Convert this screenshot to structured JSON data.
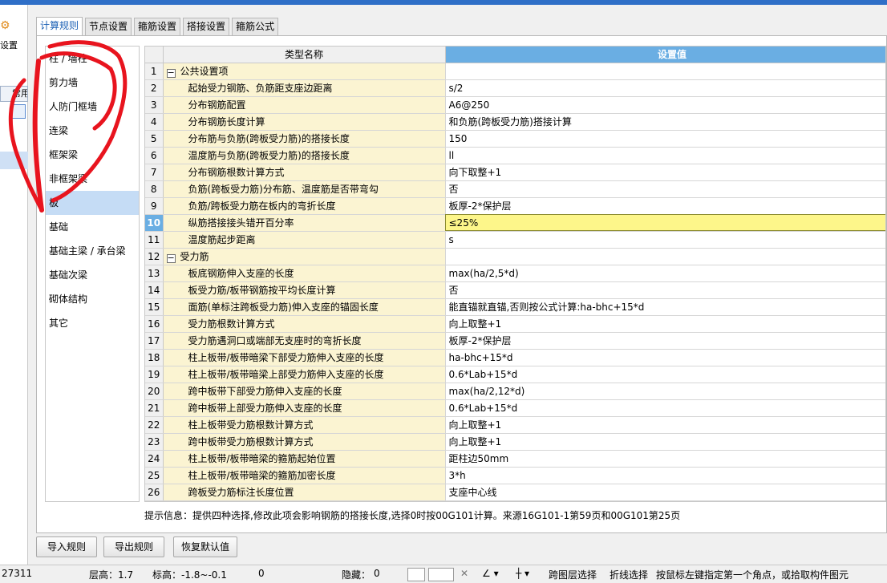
{
  "left_strip": {
    "settings_label": "设置",
    "common_label": "常用"
  },
  "tabs": [
    "计算规则",
    "节点设置",
    "箍筋设置",
    "搭接设置",
    "箍筋公式"
  ],
  "categories": [
    "柱 / 墙柱",
    "剪力墙",
    "人防门框墙",
    "连梁",
    "框架梁",
    "非框架梁",
    "板",
    "基础",
    "基础主梁 / 承台梁",
    "基础次梁",
    "砌体结构",
    "其它"
  ],
  "selected_category": "板",
  "grid": {
    "headers": {
      "name": "类型名称",
      "value": "设置值"
    },
    "rows": [
      {
        "no": "1",
        "group": true,
        "name": "公共设置项",
        "value": ""
      },
      {
        "no": "2",
        "name": "起始受力钢筋、负筋距支座边距离",
        "value": "s/2"
      },
      {
        "no": "3",
        "name": "分布钢筋配置",
        "value": "A6@250"
      },
      {
        "no": "4",
        "name": "分布钢筋长度计算",
        "value": "和负筋(跨板受力筋)搭接计算"
      },
      {
        "no": "5",
        "name": "分布筋与负筋(跨板受力筋)的搭接长度",
        "value": "150"
      },
      {
        "no": "6",
        "name": "温度筋与负筋(跨板受力筋)的搭接长度",
        "value": "ll"
      },
      {
        "no": "7",
        "name": "分布钢筋根数计算方式",
        "value": "向下取整+1"
      },
      {
        "no": "8",
        "name": "负筋(跨板受力筋)分布筋、温度筋是否带弯勾",
        "value": "否"
      },
      {
        "no": "9",
        "name": "负筋/跨板受力筋在板内的弯折长度",
        "value": "板厚-2*保护层"
      },
      {
        "no": "10",
        "name": "纵筋搭接接头错开百分率",
        "value": "≤25%",
        "highlight": true
      },
      {
        "no": "11",
        "name": "温度筋起步距离",
        "value": "s"
      },
      {
        "no": "12",
        "group": true,
        "name": "受力筋",
        "value": ""
      },
      {
        "no": "13",
        "name": "板底钢筋伸入支座的长度",
        "value": "max(ha/2,5*d)"
      },
      {
        "no": "14",
        "name": "板受力筋/板带钢筋按平均长度计算",
        "value": "否"
      },
      {
        "no": "15",
        "name": "面筋(单标注跨板受力筋)伸入支座的锚固长度",
        "value": "能直锚就直锚,否则按公式计算:ha-bhc+15*d"
      },
      {
        "no": "16",
        "name": "受力筋根数计算方式",
        "value": "向上取整+1"
      },
      {
        "no": "17",
        "name": "受力筋遇洞口或端部无支座时的弯折长度",
        "value": "板厚-2*保护层"
      },
      {
        "no": "18",
        "name": "柱上板带/板带暗梁下部受力筋伸入支座的长度",
        "value": "ha-bhc+15*d"
      },
      {
        "no": "19",
        "name": "柱上板带/板带暗梁上部受力筋伸入支座的长度",
        "value": "0.6*Lab+15*d"
      },
      {
        "no": "20",
        "name": "跨中板带下部受力筋伸入支座的长度",
        "value": "max(ha/2,12*d)"
      },
      {
        "no": "21",
        "name": "跨中板带上部受力筋伸入支座的长度",
        "value": "0.6*Lab+15*d"
      },
      {
        "no": "22",
        "name": "柱上板带受力筋根数计算方式",
        "value": "向上取整+1"
      },
      {
        "no": "23",
        "name": "跨中板带受力筋根数计算方式",
        "value": "向上取整+1"
      },
      {
        "no": "24",
        "name": "柱上板带/板带暗梁的箍筋起始位置",
        "value": "距柱边50mm"
      },
      {
        "no": "25",
        "name": "柱上板带/板带暗梁的箍筋加密长度",
        "value": "3*h"
      },
      {
        "no": "26",
        "name": "跨板受力筋标注长度位置",
        "value": "支座中心线"
      }
    ]
  },
  "info_text": "提示信息：提供四种选择,修改此项会影响钢筋的搭接长度,选择0时按00G101计算。来源16G101-1第59页和00G101第25页",
  "buttons": {
    "import": "导入规则",
    "export": "导出规则",
    "restore": "恢复默认值"
  },
  "statusbar": {
    "coord": "27311",
    "floor_height": "层高：1.7",
    "elevation": "标高：-1.8~-0.1",
    "zero": "0",
    "hidden": "隐藏：",
    "hidden_value": "0",
    "cross_layer": "跨图层选择",
    "polyline": "折线选择",
    "hint": "按鼠标左键指定第一个角点，或拾取构件图元"
  },
  "colors": {
    "accent_blue": "#6aaee3",
    "name_cell": "#fbf4d2",
    "highlight_cell": "#fdf68a",
    "annotation_red": "#e8141e"
  },
  "icons": [
    "gear-icon",
    "collapse-toggle-icon",
    "ortho-icon",
    "select-box-icon",
    "close-cross-icon",
    "angle-icon",
    "grid-icon"
  ]
}
